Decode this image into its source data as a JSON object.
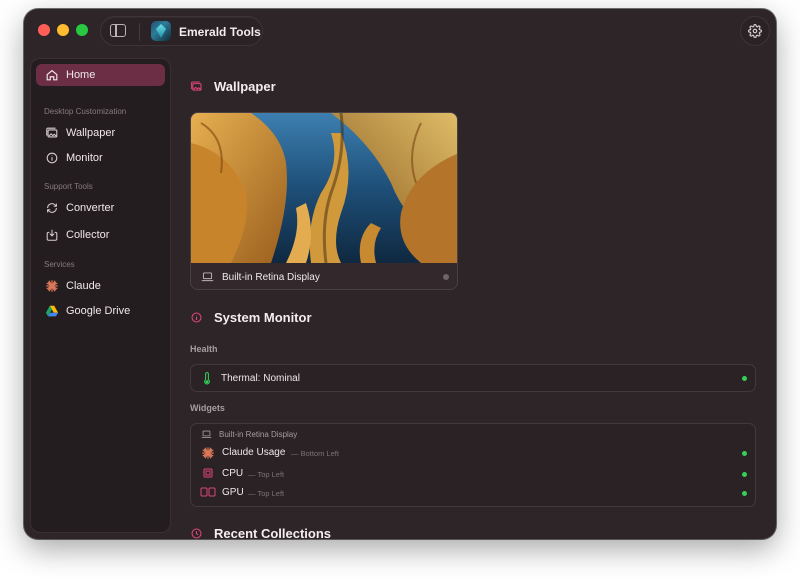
{
  "app": {
    "title": "Emerald Tools"
  },
  "sidebar": {
    "home": {
      "label": "Home",
      "icon": "house-icon"
    },
    "sections": [
      {
        "heading": "Desktop Customization",
        "items": [
          {
            "label": "Wallpaper",
            "icon": "wallpaper-icon"
          },
          {
            "label": "Monitor",
            "icon": "info-circle-icon"
          }
        ]
      },
      {
        "heading": "Support Tools",
        "items": [
          {
            "label": "Converter",
            "icon": "refresh-icon"
          },
          {
            "label": "Collector",
            "icon": "collector-icon"
          }
        ]
      },
      {
        "heading": "Services",
        "items": [
          {
            "label": "Claude",
            "icon": "claude-logo-icon"
          },
          {
            "label": "Google Drive",
            "icon": "google-drive-icon"
          }
        ]
      }
    ]
  },
  "main": {
    "wallpaper": {
      "title": "Wallpaper",
      "display_label": "Built-in Retina Display"
    },
    "system_monitor": {
      "title": "System Monitor",
      "health_heading": "Health",
      "health_item": "Thermal: Nominal",
      "widgets_heading": "Widgets",
      "widgets_display": "Built-in Retina Display",
      "widgets": [
        {
          "name": "Claude Usage",
          "position": "— Bottom Left",
          "icon": "claude-logo-icon"
        },
        {
          "name": "CPU",
          "position": "— Top Left",
          "icon": "cpu-icon"
        },
        {
          "name": "GPU",
          "position": "— Top Left",
          "icon": "gpu-icon"
        }
      ]
    },
    "recent": {
      "title": "Recent Collections"
    }
  },
  "colors": {
    "accent": "#e0457b",
    "active_nav": "#6b2e45",
    "status_green": "#34d058",
    "window_bg": "#2d2528"
  }
}
